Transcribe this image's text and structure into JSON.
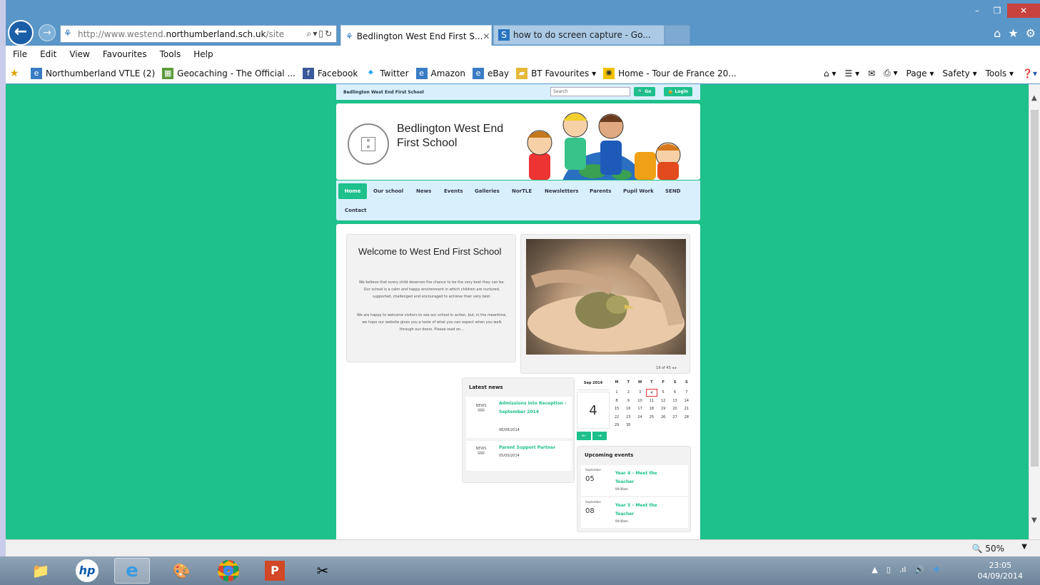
{
  "browser": {
    "url_prefix": "http://www.westend.",
    "url_domain": "northumberland.sch.uk",
    "url_suffix": "/site",
    "tabs": [
      {
        "label": "Bedlington West End First S...",
        "active": true
      },
      {
        "label": "how to do screen capture - Go...",
        "active": false
      }
    ],
    "menu": [
      "File",
      "Edit",
      "View",
      "Favourites",
      "Tools",
      "Help"
    ],
    "favourites": [
      "Northumberland VTLE (2)",
      "Geocaching - The Official ...",
      "Facebook",
      "Twitter",
      "Amazon",
      "eBay",
      "BT Favourites ▾",
      "Home - Tour de France 20..."
    ],
    "commands": [
      "Page ▾",
      "Safety ▾",
      "Tools ▾"
    ],
    "zoom": "50%"
  },
  "site": {
    "topbar_title": "Bedlington West End First School",
    "search_placeholder": "Search",
    "go_label": "Go",
    "login_label": "Login",
    "school_name_line1": "Bedlington West End",
    "school_name_line2": "First School",
    "nav": [
      "Home",
      "Our school",
      "News",
      "Events",
      "Galleries",
      "NorTLE",
      "Newsletters",
      "Parents",
      "Pupil Work",
      "SEND",
      "Contact"
    ],
    "welcome_title": "Welcome to West End First School",
    "welcome_p1": "We believe that every child deserves the chance to be the very best they can be. Our school is a calm and happy environment in which children are nurtured, supported, challenged and encouraged to achieve their very best.",
    "welcome_p2": "We are happy to welcome visitors to see our school in action, but, in the meantime, we hope our website gives you a taste of what you can expect when you walk through our doors. Please read on...",
    "slide_count": "19 of 45",
    "latest_news_title": "Latest news",
    "news": [
      {
        "title": "Admissions into Reception – September 2014",
        "date": "06/08/2014"
      },
      {
        "title": "Parent Support Partner",
        "date": "05/05/2014"
      }
    ],
    "calendar": {
      "month": "Sep 2014",
      "big_day": "4",
      "headers": [
        "M",
        "T",
        "W",
        "T",
        "F",
        "S",
        "S"
      ],
      "weeks": [
        [
          "1",
          "2",
          "3",
          "4",
          "5",
          "6",
          "7"
        ],
        [
          "8",
          "9",
          "10",
          "11",
          "12",
          "13",
          "14"
        ],
        [
          "15",
          "16",
          "17",
          "18",
          "19",
          "20",
          "21"
        ],
        [
          "22",
          "23",
          "24",
          "25",
          "26",
          "27",
          "28"
        ],
        [
          "29",
          "30",
          "",
          "",
          "",
          "",
          ""
        ]
      ]
    },
    "upcoming_title": "Upcoming events",
    "events": [
      {
        "month": "September",
        "day": "05",
        "title": "Year 4 – Meet the Teacher",
        "time": "09:00am"
      },
      {
        "month": "September",
        "day": "08",
        "title": "Year 5 – Meet the Teacher",
        "time": "09:00am"
      }
    ]
  },
  "taskbar": {
    "time": "23:05",
    "date": "04/09/2014"
  },
  "colors": {
    "page_bg": "#1ec08b",
    "chrome_blue": "#5a96c7",
    "header_light": "#d8f0fb"
  }
}
